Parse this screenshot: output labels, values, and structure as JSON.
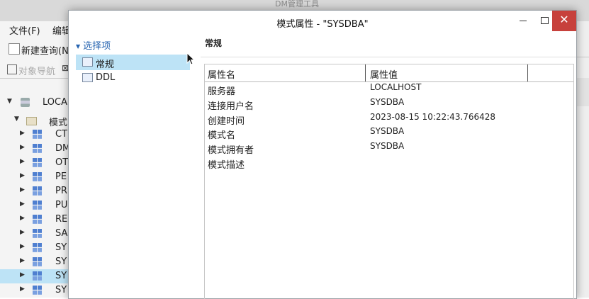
{
  "background_app": {
    "title": "DM管理工具",
    "menu": [
      "文件(F)",
      "编辑"
    ],
    "toolbar_new_query": "新建查询(N",
    "nav_tab_label": "对象导航",
    "tree": {
      "root": "LOCAL",
      "schema_folder": "模式",
      "items": [
        "CT",
        "DM",
        "OT",
        "PE",
        "PR",
        "PU",
        "RE",
        "SA",
        "SY",
        "SY",
        "SY",
        "SY"
      ]
    }
  },
  "dialog": {
    "title": "模式属性 - \"SYSDBA\"",
    "left_pane": {
      "header": "选择项",
      "items": [
        {
          "label": "常规"
        },
        {
          "label": "DDL"
        }
      ]
    },
    "content": {
      "heading": "常规",
      "columns": [
        "属性名",
        "属性值"
      ],
      "rows": [
        {
          "name": "服务器",
          "value": "LOCALHOST"
        },
        {
          "name": "连接用户名",
          "value": "SYSDBA"
        },
        {
          "name": "创建时间",
          "value": "2023-08-15 10:22:43.766428"
        },
        {
          "name": "模式名",
          "value": "SYSDBA"
        },
        {
          "name": "模式拥有者",
          "value": "SYSDBA"
        },
        {
          "name": "模式描述",
          "value": ""
        }
      ]
    },
    "window_controls": {
      "minimize": "minimize-icon",
      "maximize": "maximize-icon",
      "close": "close-icon"
    }
  },
  "colors": {
    "selection": "#bde3f6",
    "header_blue": "#2563b0",
    "close_red": "#c7413c"
  }
}
